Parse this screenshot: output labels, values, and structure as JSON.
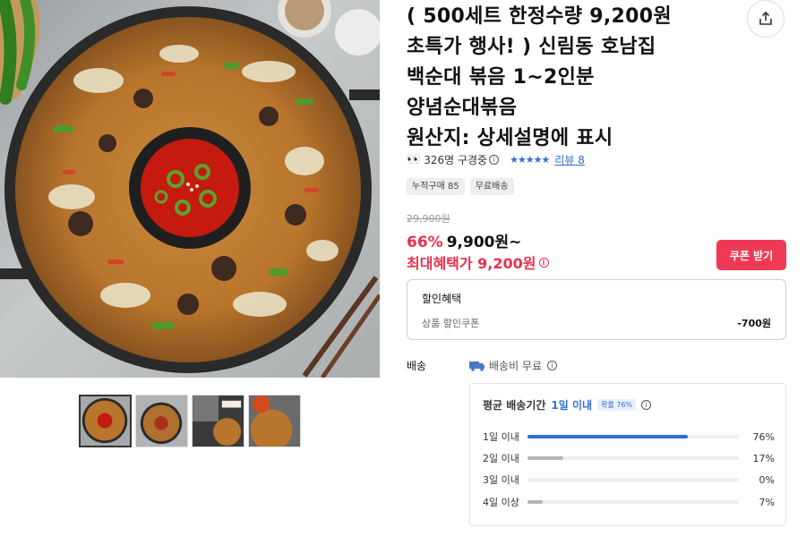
{
  "product": {
    "title_lines": [
      "( 500세트 한정수량 9,200원",
      "초특가 행사! ) 신림동 호남집",
      "백순대 볶음 1~2인분",
      "양념순대볶음",
      "원산지: 상세설명에 표시"
    ],
    "viewers": "326명 구경중",
    "review_label": "리뷰 8",
    "rating_stars": 5
  },
  "icons": {
    "share": "share-icon",
    "eyes": "eyes-icon",
    "info": "info-icon",
    "truck": "truck-icon"
  },
  "tags": [
    "누적구매 85",
    "무료배송"
  ],
  "pricing": {
    "original": "29,900원",
    "discount": "66%",
    "price": "9,900원~",
    "max_benefit": "최대혜택가 9,200원",
    "coupon_button": "쿠폰 받기"
  },
  "discount_box": {
    "title": "할인혜택",
    "label": "상품 할인쿠폰",
    "amount": "-700원"
  },
  "shipping": {
    "label": "배송",
    "fee": "배송비 무료",
    "avg_title": "평균 배송기간",
    "avg_value": "1일 이내",
    "prob": "확률 76%",
    "distribution": [
      {
        "label": "1일 이내",
        "value": "76%",
        "fraction": 0.76,
        "color": "#2f6fd8"
      },
      {
        "label": "2일 이내",
        "value": "17%",
        "fraction": 0.17,
        "color": "#b5b5b5"
      },
      {
        "label": "3일 이내",
        "value": "0%",
        "fraction": 0.0,
        "color": "#b5b5b5"
      },
      {
        "label": "4일 이상",
        "value": "7%",
        "fraction": 0.07,
        "color": "#b5b5b5"
      }
    ]
  },
  "colors": {
    "accent_red": "#e8314f",
    "accent_blue": "#2f6fd8"
  }
}
